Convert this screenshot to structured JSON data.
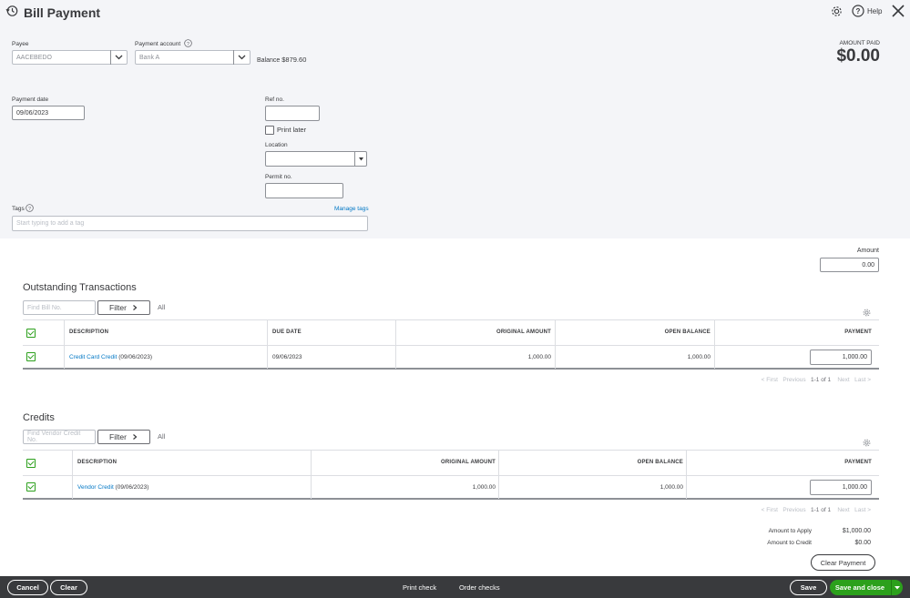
{
  "header": {
    "title": "Bill Payment",
    "help_label": "Help"
  },
  "payee": {
    "label": "Payee",
    "value": "AACEBEDO"
  },
  "payment_account": {
    "label": "Payment account",
    "value": "Bank A",
    "balance_label": "Balance",
    "balance_value": "$879.60"
  },
  "amount_paid": {
    "label": "AMOUNT PAID",
    "value": "$0.00"
  },
  "payment_date": {
    "label": "Payment date",
    "value": "09/06/2023"
  },
  "ref_no": {
    "label": "Ref no.",
    "value": ""
  },
  "print_later": {
    "label": "Print later",
    "checked": false
  },
  "location": {
    "label": "Location",
    "value": ""
  },
  "permit_no": {
    "label": "Permit no.",
    "value": ""
  },
  "tags": {
    "label": "Tags",
    "manage_label": "Manage tags",
    "placeholder": "Start typing to add a tag"
  },
  "amount": {
    "label": "Amount",
    "value": "0.00"
  },
  "outstanding": {
    "title": "Outstanding Transactions",
    "search_placeholder": "Find Bill No.",
    "filter_label": "Filter",
    "all_label": "All",
    "columns": {
      "description": "DESCRIPTION",
      "due_date": "DUE DATE",
      "original_amount": "ORIGINAL AMOUNT",
      "open_balance": "OPEN BALANCE",
      "payment": "PAYMENT"
    },
    "rows": [
      {
        "description_link": "Credit Card Credit",
        "description_date": " (09/06/2023)",
        "due_date": "09/06/2023",
        "original_amount": "1,000.00",
        "open_balance": "1,000.00",
        "payment": "1,000.00",
        "checked": true
      }
    ],
    "pager": {
      "first": "< First",
      "previous": "Previous",
      "range": "1-1 of 1",
      "next": "Next",
      "last": "Last >"
    }
  },
  "credits": {
    "title": "Credits",
    "search_placeholder": "Find Vendor Credit No.",
    "filter_label": "Filter",
    "all_label": "All",
    "columns": {
      "description": "DESCRIPTION",
      "original_amount": "ORIGINAL AMOUNT",
      "open_balance": "OPEN BALANCE",
      "payment": "PAYMENT"
    },
    "rows": [
      {
        "description_link": "Vendor Credit",
        "description_date": " (09/06/2023)",
        "original_amount": "1,000.00",
        "open_balance": "1,000.00",
        "payment": "1,000.00",
        "checked": true
      }
    ],
    "pager": {
      "first": "< First",
      "previous": "Previous",
      "range": "1-1 of 1",
      "next": "Next",
      "last": "Last >"
    }
  },
  "summary": {
    "amount_to_apply_label": "Amount to Apply",
    "amount_to_apply_value": "$1,000.00",
    "amount_to_credit_label": "Amount to Credit",
    "amount_to_credit_value": "$0.00",
    "clear_payment_label": "Clear Payment"
  },
  "footer": {
    "cancel_label": "Cancel",
    "clear_label": "Clear",
    "print_check_label": "Print check",
    "order_checks_label": "Order checks",
    "save_label": "Save",
    "save_close_label": "Save and close"
  },
  "colors": {
    "accent_green": "#2ca01c",
    "link_blue": "#0077c5",
    "footer_bg": "#393a3d",
    "top_bg": "#f4f5f8"
  }
}
